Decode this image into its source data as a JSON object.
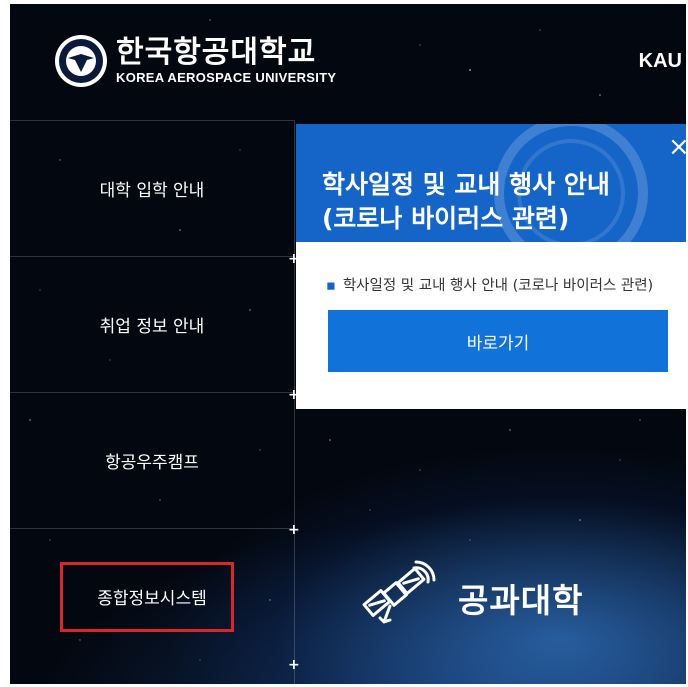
{
  "header": {
    "logo_korean": "한국항공대학교",
    "logo_english": "KOREA AEROSPACE UNIVERSITY",
    "kau_label": "KAU"
  },
  "sidebar": {
    "items": [
      {
        "label": "대학 입학 안내"
      },
      {
        "label": "취업 정보 안내"
      },
      {
        "label": "항공우주캠프"
      },
      {
        "label": "종합정보시스템"
      }
    ]
  },
  "popup": {
    "title_line1": "학사일정 및 교내 행사 안내",
    "title_line2": "(코로나 바이러스 관련)",
    "close_symbol": "×",
    "bullet_text": "학사일정 및 교내 행사 안내 (코로나 바이러스 관련)",
    "go_button_label": "바로가기"
  },
  "banner": {
    "college_label": "공과대학",
    "icon": "satellite-icon"
  },
  "colors": {
    "popup_header": "#1565c8",
    "button": "#1172d9",
    "highlight": "#d8262c",
    "background": "#03070f"
  }
}
